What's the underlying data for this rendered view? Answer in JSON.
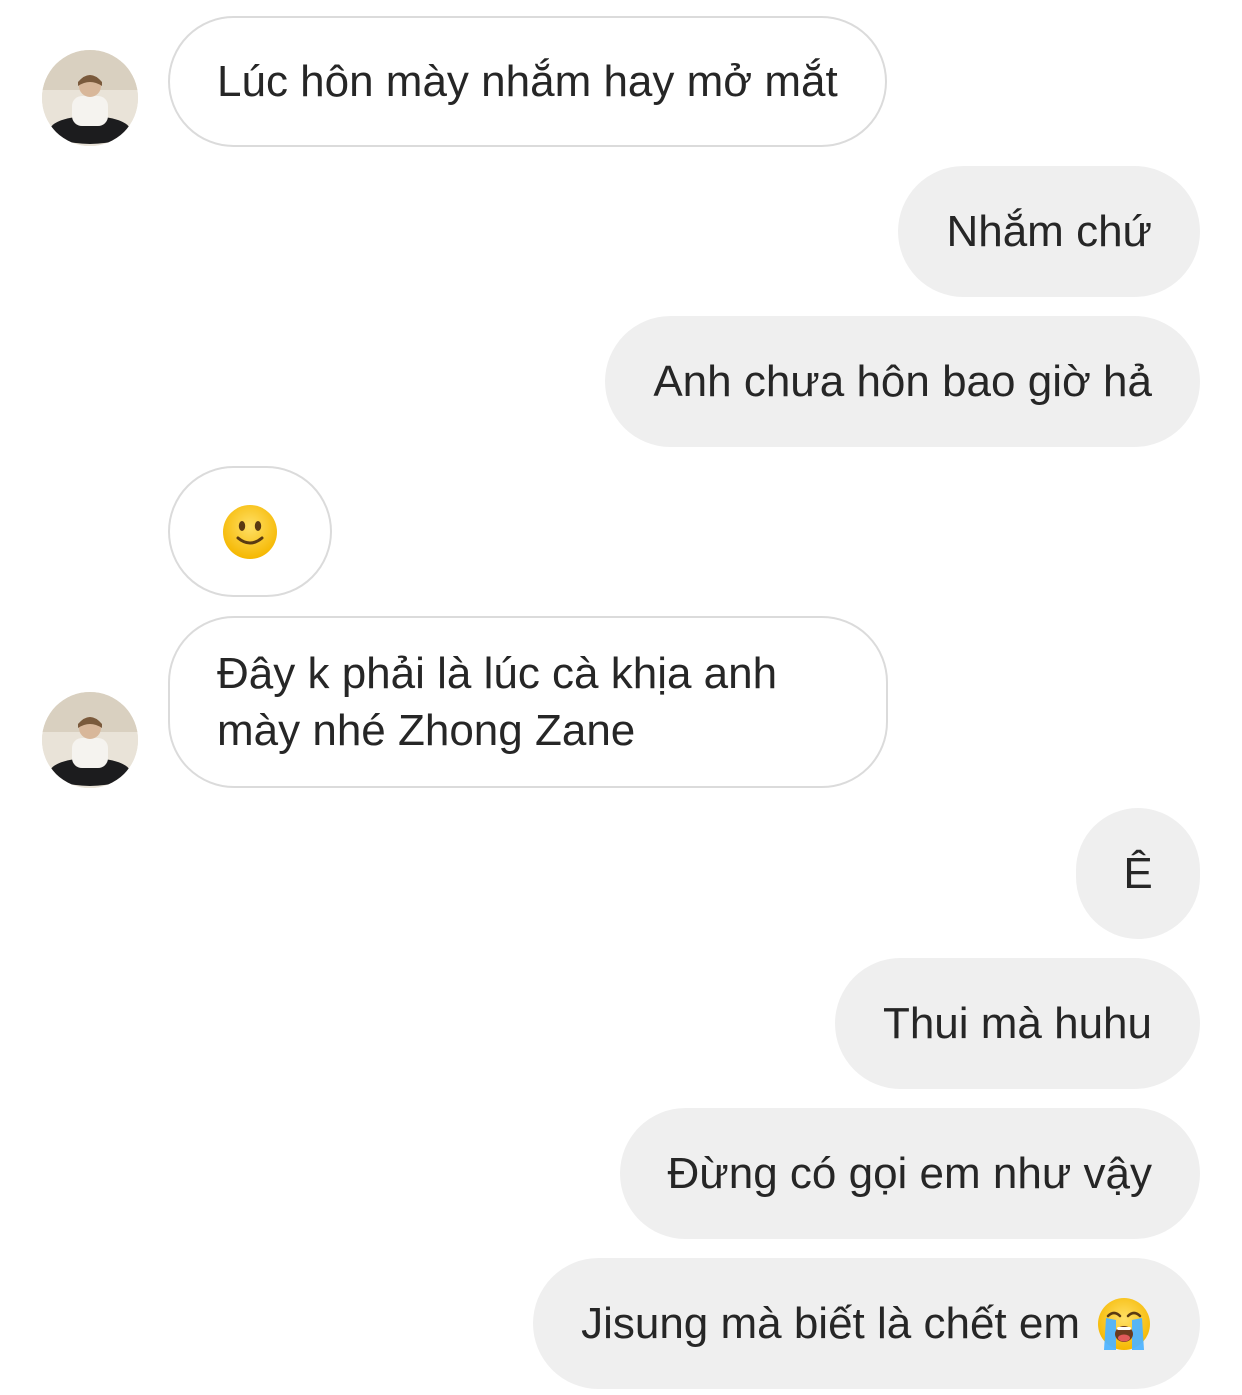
{
  "messages": [
    {
      "sender": "them",
      "text": "Lúc hôn mày nhắm hay mở mắt"
    },
    {
      "sender": "me",
      "text": "Nhắm chứ"
    },
    {
      "sender": "me",
      "text": "Anh chưa hôn bao giờ hả"
    },
    {
      "sender": "them",
      "emoji": "slightly-smiling-face-icon"
    },
    {
      "sender": "them",
      "text_line1": "Đây k phải là lúc cà khịa anh",
      "text_line2": "mày nhé Zhong Zane"
    },
    {
      "sender": "me",
      "text": "Ê"
    },
    {
      "sender": "me",
      "text": "Thui mà huhu"
    },
    {
      "sender": "me",
      "text": "Đừng có gọi em như vậy"
    },
    {
      "sender": "me",
      "text": "Jisung mà biết là chết em",
      "emoji": "loudly-crying-face-icon"
    }
  ],
  "colors": {
    "incoming_bubble_border": "#dbdbdb",
    "outgoing_bubble_bg": "#efefef",
    "text": "#262626"
  }
}
